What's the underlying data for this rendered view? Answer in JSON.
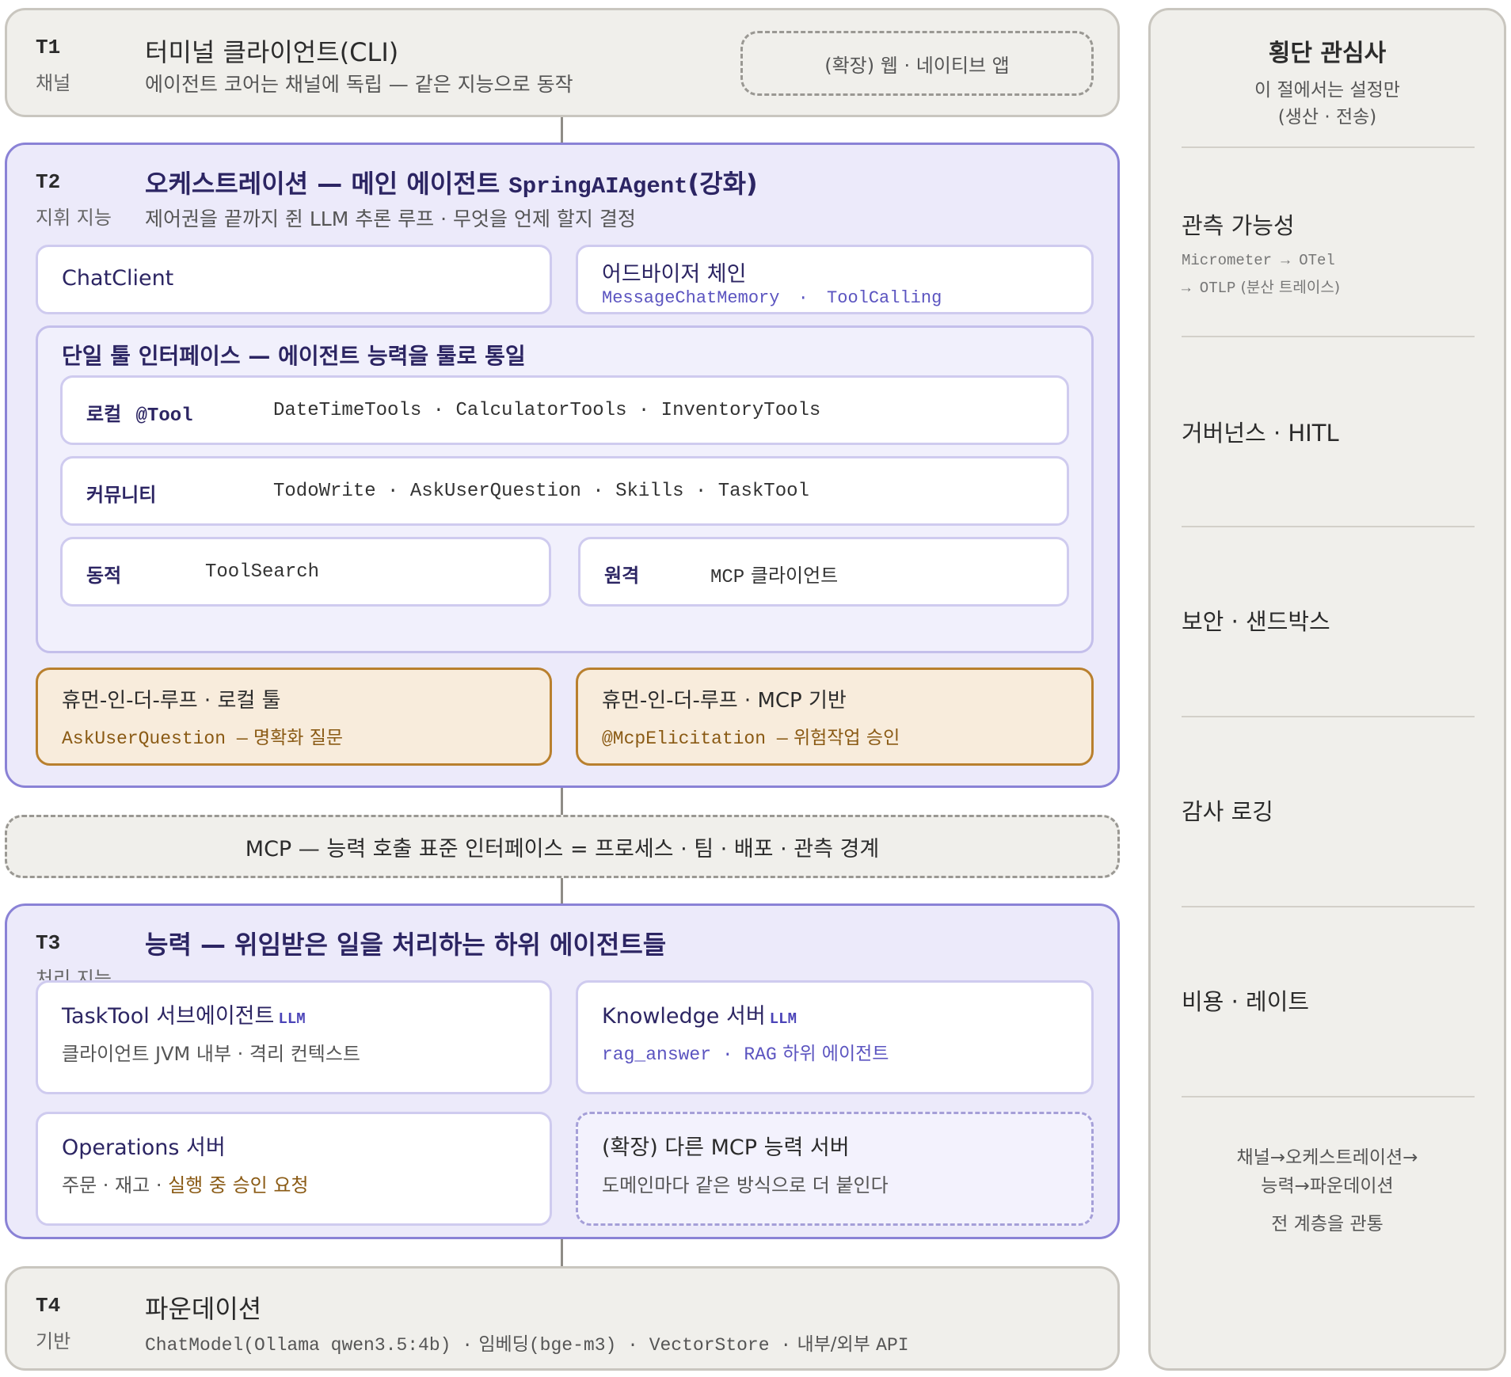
{
  "t1": {
    "tag": "T1",
    "sub": "채널",
    "title": "터미널 클라이언트(CLI)",
    "desc": "에이전트 코어는 채널에 독립 — 같은 지능으로 동작",
    "ext": "(확장) 웹 · 네이티브 앱"
  },
  "t2": {
    "tag": "T2",
    "sub": "지휘 지능",
    "title_text": "오케스트레이션 — 메인 에이전트 ",
    "title_mono": "SpringAIAgent",
    "title_suffix": "(강화)",
    "desc": "제어권을 끝까지 쥔 LLM 추론 루프 · 무엇을 언제 할지 결정",
    "chatclient": "ChatClient",
    "advisor": {
      "title": "어드바이저 체인",
      "item1": "MessageChatMemory",
      "sep": "·",
      "item2": "ToolCalling"
    },
    "tools": {
      "title": "단일 툴 인터페이스 — 에이전트 능력을 툴로 통일",
      "local": {
        "label": "로컬",
        "mono": "@Tool",
        "items": "DateTimeTools · CalculatorTools · InventoryTools"
      },
      "community": {
        "label": "커뮤니티",
        "items": "TodoWrite · AskUserQuestion · Skills · TaskTool"
      },
      "dynamic": {
        "label": "동적",
        "items": "ToolSearch"
      },
      "remote": {
        "label": "원격",
        "mono": "MCP",
        "items": "클라이언트"
      }
    },
    "hitl_local": {
      "title": "휴먼-인-더-루프 · 로컬 툴",
      "mono": "AskUserQuestion —",
      "text": "명확화 질문"
    },
    "hitl_mcp": {
      "title": "휴먼-인-더-루프 · MCP 기반",
      "mono": "@McpElicitation —",
      "text": "위험작업 승인"
    }
  },
  "mcp_bar": "MCP — 능력 호출 표준 인터페이스 = 프로세스 · 팀 · 배포 · 관측 경계",
  "t3": {
    "tag": "T3",
    "sub": "처리 지능",
    "title": "능력 — 위임받은 일을 처리하는 하위 에이전트들",
    "tasktool": {
      "title": "TaskTool 서브에이전트",
      "badge": "LLM",
      "desc": "클라이언트 JVM 내부 · 격리 컨텍스트"
    },
    "knowledge": {
      "title": "Knowledge 서버",
      "badge": "LLM",
      "mono": "rag_answer · RAG",
      "desc": "하위 에이전트"
    },
    "operations": {
      "title": "Operations 서버",
      "desc_plain": "주문 · 재고 · ",
      "desc_hl": "실행 중 승인 요청"
    },
    "ext": {
      "title": "(확장) 다른 MCP 능력 서버",
      "desc": "도메인마다 같은 방식으로 더 붙인다"
    }
  },
  "t4": {
    "tag": "T4",
    "sub": "기반",
    "title": "파운데이션",
    "m1": "ChatModel(Ollama qwen3.5:4b) ·",
    "k1": "임베딩",
    "m2": "(bge-m3) · VectorStore ·",
    "k2": "내부/외부",
    "m3": "API"
  },
  "side": {
    "title": "횡단 관심사",
    "sub1": "이 절에서는 설정만",
    "sub2": "(생산 · 전송)",
    "obs": "관측 가능성",
    "obs_l1": "Micrometer → OTel",
    "obs_l2_mono": "→ OTLP",
    "obs_l2_text": "(분산 트레이스)",
    "gov": "거버넌스 · HITL",
    "sec": "보안 · 샌드박스",
    "audit": "감사 로깅",
    "cost": "비용 · 레이트",
    "foot1": "채널→오케스트레이션→",
    "foot2": "능력→파운데이션",
    "foot3": "전 계층을 관통"
  },
  "colors": {
    "purple_accent": "#8a82d6",
    "amber_accent": "#b9802e",
    "navy_text": "#2c2563",
    "mono_purple": "#5b54c0"
  }
}
